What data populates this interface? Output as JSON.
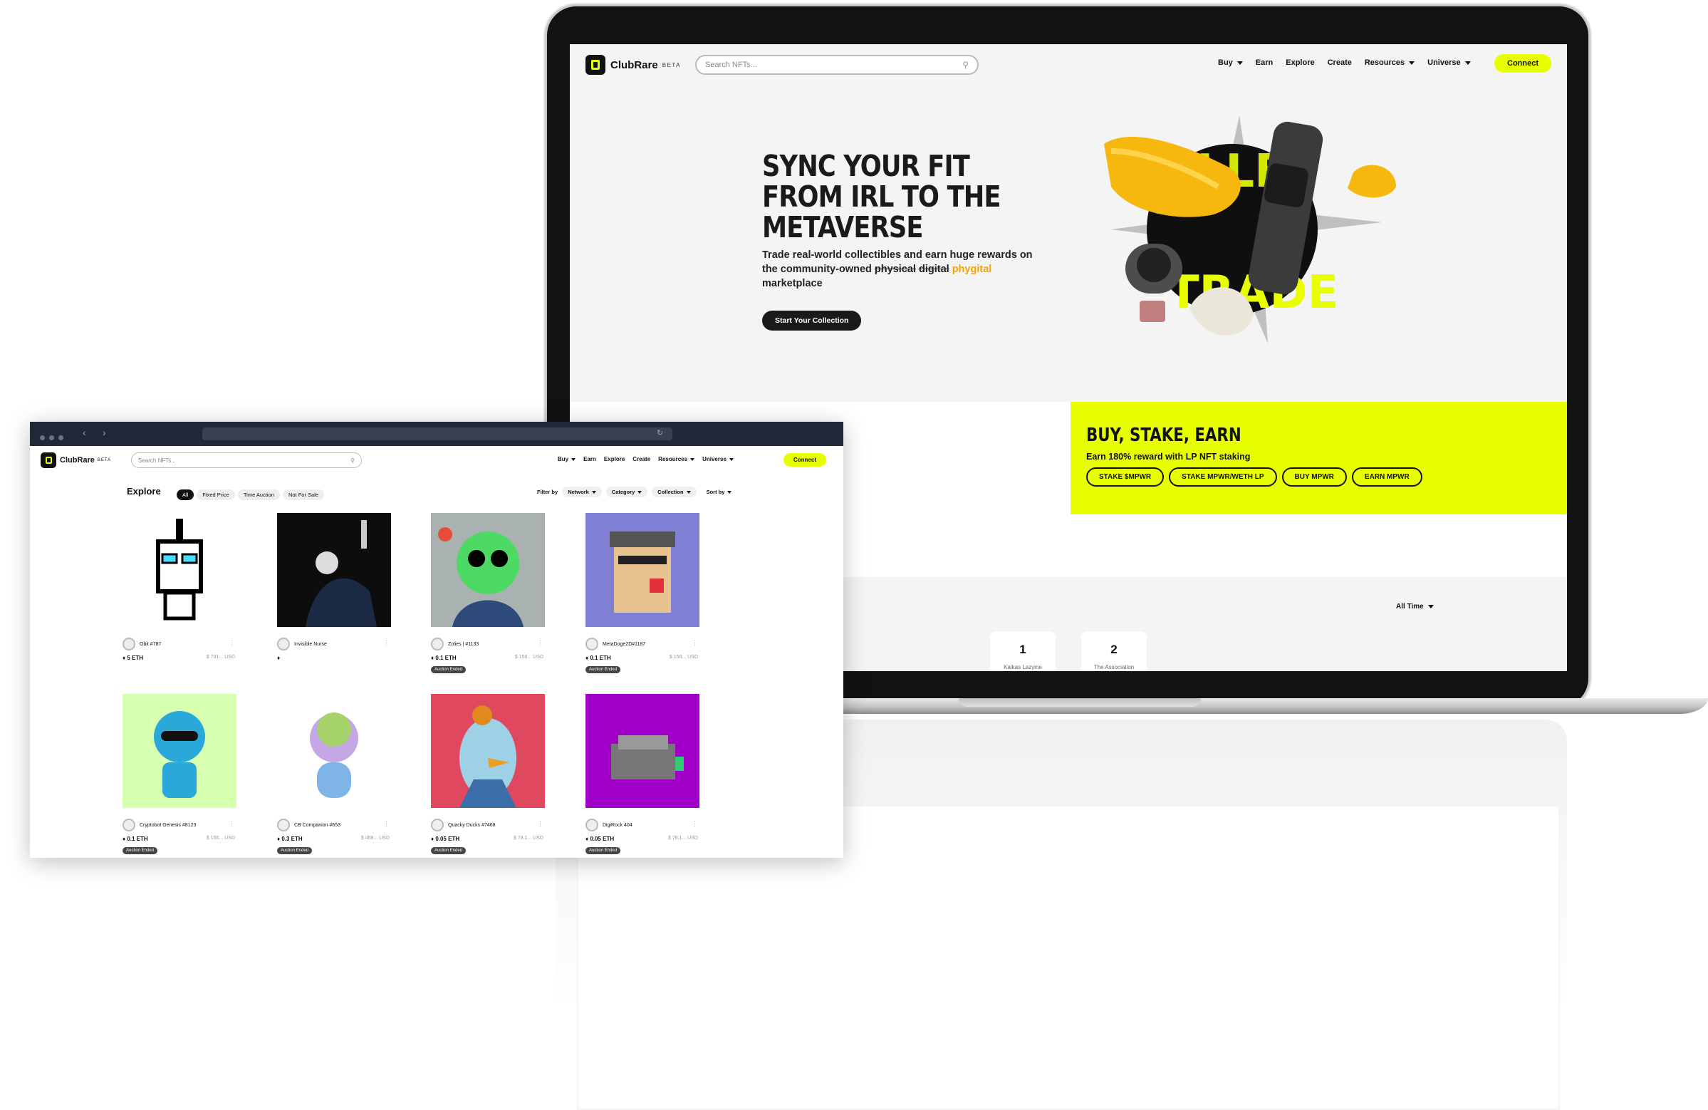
{
  "laptop": {
    "nav": {
      "brand": "ClubRare",
      "beta": "BETA",
      "search_placeholder": "Search NFTs...",
      "items": [
        "Buy",
        "Earn",
        "Explore",
        "Create",
        "Resources",
        "Universe"
      ],
      "connect": "Connect"
    },
    "hero": {
      "title_line1": "SYNC YOUR FIT",
      "title_line2": "FROM IRL TO THE",
      "title_line3": "METAVERSE",
      "sub_before": "Trade real-world collectibles and earn huge rewards on the community-owned ",
      "sub_strike1": "physical",
      "sub_strike2": "digital",
      "sub_highlight": "phygital",
      "sub_after": "marketplace",
      "cta": "Start Your Collection",
      "art_text": "TRADE"
    },
    "stake_panel": {
      "title": "BUY, STAKE, EARN",
      "subtitle": "Earn 180% reward with LP NFT staking",
      "buttons": [
        "STAKE $MPWR",
        "STAKE MPWR/WETH LP",
        "BUY MPWR",
        "EARN MPWR"
      ]
    },
    "ranking": {
      "filter": "All Time",
      "items": [
        {
          "rank": "1",
          "name": "Kaikas Lazyine"
        },
        {
          "rank": "2",
          "name": "The Association"
        }
      ]
    }
  },
  "browser": {
    "nav": {
      "brand": "ClubRare",
      "beta": "BETA",
      "search_placeholder": "Search NFTs...",
      "items": [
        "Buy",
        "Earn",
        "Explore",
        "Create",
        "Resources",
        "Universe"
      ],
      "connect": "Connect"
    },
    "explore": {
      "title": "Explore",
      "tabs": [
        "All",
        "Fixed Price",
        "Time Auction",
        "Not For Sale"
      ],
      "filter_label": "Filter by",
      "filters": [
        "Network",
        "Category",
        "Collection"
      ],
      "sort_label": "Sort by"
    },
    "cards": [
      {
        "name": "Obit #787",
        "price": "5 ETH",
        "usd": "$ 781... USD",
        "badge": "",
        "bg": "#ffffff"
      },
      {
        "name": "Invisible Nurse",
        "price": "",
        "usd": "",
        "badge": "",
        "bg": "#0d0d0d"
      },
      {
        "name": "Zolies | #1133",
        "price": "0.1 ETH",
        "usd": "$ 156... USD",
        "badge": "Auction Ended",
        "bg": "#a9b1b1"
      },
      {
        "name": "MetaDoge2D#1187",
        "price": "0.1 ETH",
        "usd": "$ 156... USD",
        "badge": "Auction Ended",
        "bg": "#7f7fd4"
      },
      {
        "name": "Cryptobot Genesis #8123",
        "price": "0.1 ETH",
        "usd": "$ 156... USD",
        "badge": "Auction Ended",
        "bg": "#d7ffb0"
      },
      {
        "name": "CB Companion #653",
        "price": "0.3 ETH",
        "usd": "$ 468... USD",
        "badge": "Auction Ended",
        "bg": "#ffffff"
      },
      {
        "name": "Quacky Ducks #7468",
        "price": "0.05 ETH",
        "usd": "$ 78.1... USD",
        "badge": "Auction Ended",
        "bg": "#e0485f"
      },
      {
        "name": "DigiRock 404",
        "price": "0.05 ETH",
        "usd": "$ 78.1... USD",
        "badge": "Auction Ended",
        "bg": "#a000c8"
      }
    ]
  },
  "colors": {
    "accent": "#e8ff00",
    "dark": "#111111",
    "orange": "#f5a300"
  }
}
